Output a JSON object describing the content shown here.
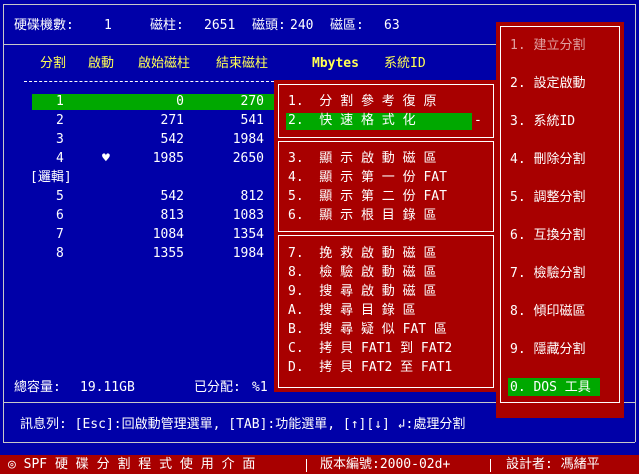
{
  "header": {
    "disk_count_label": "硬碟機數:",
    "disk_count_value": "1",
    "cylinders_label": "磁柱:",
    "cylinders_value": "2651",
    "heads_label": "磁頭:",
    "heads_value": "240",
    "sectors_label": "磁區:",
    "sectors_value": "63"
  },
  "table": {
    "columns": [
      "分割",
      "啟動",
      "啟始磁柱",
      "結束磁柱",
      "Mbytes",
      "系統ID"
    ],
    "logical_label": "[邏輯]",
    "rows": [
      {
        "part": "1",
        "boot": "",
        "start": "0",
        "end": "270",
        "selected": true
      },
      {
        "part": "2",
        "boot": "",
        "start": "271",
        "end": "541"
      },
      {
        "part": "3",
        "boot": "",
        "start": "542",
        "end": "1984"
      },
      {
        "part": "4",
        "boot": "♥",
        "start": "1985",
        "end": "2650"
      },
      {
        "part": "5",
        "boot": "",
        "start": "542",
        "end": "812"
      },
      {
        "part": "6",
        "boot": "",
        "start": "813",
        "end": "1083"
      },
      {
        "part": "7",
        "boot": "",
        "start": "1084",
        "end": "1354"
      },
      {
        "part": "8",
        "boot": "",
        "start": "1355",
        "end": "1984"
      }
    ]
  },
  "summary": {
    "total_label": "總容量:",
    "total_value": "19.11GB",
    "allocated_label": "已分配:",
    "allocated_value": "%1"
  },
  "popup_menu": {
    "group1": [
      "1.  分 割 參 考 復 原",
      "2.  快 速 格 式 化"
    ],
    "group2": [
      "3.  顯 示 啟 動 磁 區",
      "4.  顯 示 第 一 份 FAT",
      "5.  顯 示 第 二 份 FAT",
      "6.  顯 示 根 目 錄 區"
    ],
    "group3": [
      "7.  挽 救 啟 動 磁 區",
      "8.  檢 驗 啟 動 磁 區",
      "9.  搜 尋 啟 動 磁 區",
      "A.  搜 尋 目 錄 區",
      "B.  搜 尋 疑 似 FAT 區",
      "C.  拷 貝 FAT1 到 FAT2",
      "D.  拷 貝 FAT2 至 FAT1"
    ],
    "selected_index": 1
  },
  "function_menu": {
    "items": [
      "1. 建立分割",
      "2. 設定啟動",
      "3. 系統ID",
      "4. 刪除分割",
      "5. 調整分割",
      "6. 互換分割",
      "7. 檢驗分割",
      "8. 傾印磁區",
      "9. 隱藏分割",
      "0. DOS 工具"
    ],
    "selected_index": 9
  },
  "message_bar": {
    "text": "訊息列: [Esc]:回啟動管理選單, [TAB]:功能選單, [↑][↓] ↲:處理分割"
  },
  "footer": {
    "app_name": "◎ SPF 硬 碟 分 割 程 式 使 用 介 面",
    "version_label": "版本編號:2000-02d+",
    "designer_label": "設計者: 馮緒平"
  },
  "colors": {
    "background": "#0000a8",
    "panel": "#a80000",
    "selection": "#00a800",
    "header_text": "#ffff54"
  }
}
